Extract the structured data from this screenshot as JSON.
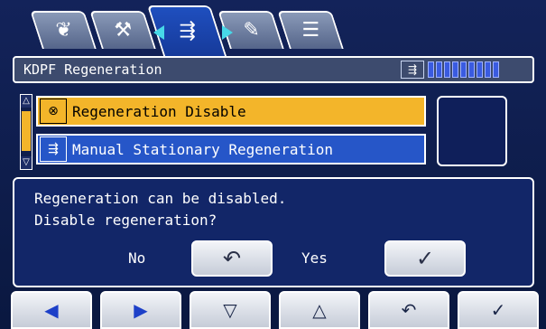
{
  "tabs": [
    {
      "icon": "leaf-icon",
      "glyph": "❦"
    },
    {
      "icon": "service-tool-icon",
      "glyph": "⚒"
    },
    {
      "icon": "dpf-exhaust-icon",
      "glyph": "⇶"
    },
    {
      "icon": "book-icon",
      "glyph": "✎"
    },
    {
      "icon": "list-icon",
      "glyph": "☰"
    }
  ],
  "header": {
    "title": "KDPF Regeneration",
    "status_icon": "dpf-status-icon",
    "status_glyph": "⇶",
    "level_bar_segments": 9
  },
  "list": {
    "items": [
      {
        "label": "Regeneration Disable",
        "icon": "regeneration-disable-icon",
        "glyph": "⊗",
        "selected": true
      },
      {
        "label": "Manual Stationary Regeneration",
        "icon": "manual-regeneration-icon",
        "glyph": "⇶",
        "selected": false
      }
    ],
    "scroll_up_glyph": "△",
    "scroll_down_glyph": "▽"
  },
  "dialog": {
    "line1": "Regeneration can be disabled.",
    "line2": "Disable regeneration?",
    "no_label": "No",
    "yes_label": "Yes",
    "no_button_glyph": "↶",
    "yes_button_glyph": "✓"
  },
  "bottom_buttons": [
    {
      "name": "left-button",
      "glyph": "◀"
    },
    {
      "name": "right-button",
      "glyph": "▶"
    },
    {
      "name": "down-button",
      "glyph": "▽"
    },
    {
      "name": "up-button",
      "glyph": "△"
    },
    {
      "name": "return-button",
      "glyph": "↶"
    },
    {
      "name": "enter-button",
      "glyph": "✓"
    }
  ],
  "colors": {
    "selected_item": "#f3b52a",
    "item_blue": "#2656c8",
    "active_tab": "#1f4fbf",
    "tab_arrow": "#47d8e8",
    "background": "#13235a"
  }
}
